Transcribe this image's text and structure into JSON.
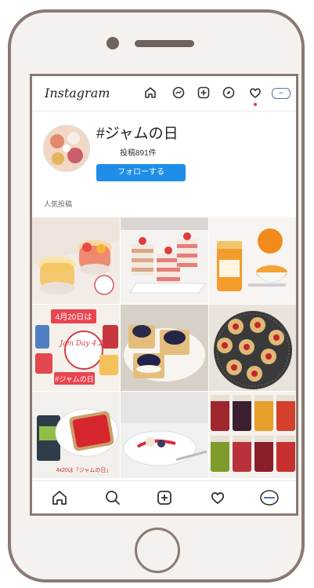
{
  "header": {
    "logo": "Instagram",
    "icons": [
      "home-icon",
      "messenger-icon",
      "new-post-icon",
      "explore-icon",
      "activity-heart-icon",
      "profile-icon"
    ]
  },
  "hashtag_page": {
    "title": "#ジャムの日",
    "post_count": "投稿891件",
    "follow_label": "フォローする",
    "section_label": "人気投稿"
  },
  "grid": {
    "tiles": [
      {
        "name": "fruit-jelly-cups"
      },
      {
        "name": "strawberry-layer-cakes"
      },
      {
        "name": "orange-marmalade-jar"
      },
      {
        "name": "jam-day-promo",
        "texts": [
          "4月20日は",
          "Jam Day 4.20",
          "#ジャムの日"
        ]
      },
      {
        "name": "blueberry-crackers"
      },
      {
        "name": "jam-thumbprint-cookies"
      },
      {
        "name": "jam-toast",
        "texts": [
          "4x20は「ジャムの日」"
        ]
      },
      {
        "name": "dessert-plate"
      },
      {
        "name": "jam-jar-assortment"
      }
    ]
  },
  "bottom_nav": {
    "icons": [
      "home-icon",
      "search-icon",
      "new-post-icon",
      "activity-heart-icon",
      "profile-icon"
    ]
  },
  "colors": {
    "phone_frame": "#8a7a72",
    "phone_body": "#f4f1ef",
    "follow_button": "#1f8ee8",
    "notification_dot": "#e3344f"
  }
}
